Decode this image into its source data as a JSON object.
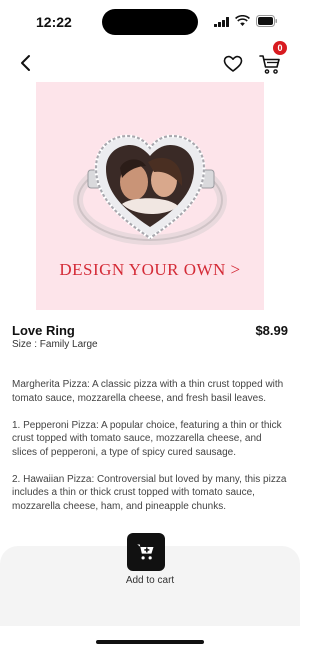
{
  "status_bar": {
    "time": "12:22"
  },
  "nav": {
    "cart_count": "0"
  },
  "product": {
    "banner_text": "DESIGN YOUR OWN >",
    "title": "Love Ring",
    "size": "Size : Family Large",
    "price": "$8.99",
    "description": [
      "Margherita Pizza: A classic pizza with a thin crust topped with tomato sauce, mozzarella cheese, and fresh basil leaves.",
      "1. Pepperoni Pizza: A popular choice, featuring a thin or thick crust topped with tomato sauce, mozzarella cheese, and slices of pepperoni, a type of spicy cured sausage.",
      "2. Hawaiian Pizza: Controversial but loved by many, this pizza includes a thin or thick crust topped with tomato sauce, mozzarella cheese, ham, and pineapple chunks."
    ]
  },
  "actions": {
    "add_to_cart_label": "Add to cart"
  },
  "colors": {
    "accent": "#d42b37",
    "badge": "#d81b20",
    "banner_bg": "#fde4ea"
  }
}
